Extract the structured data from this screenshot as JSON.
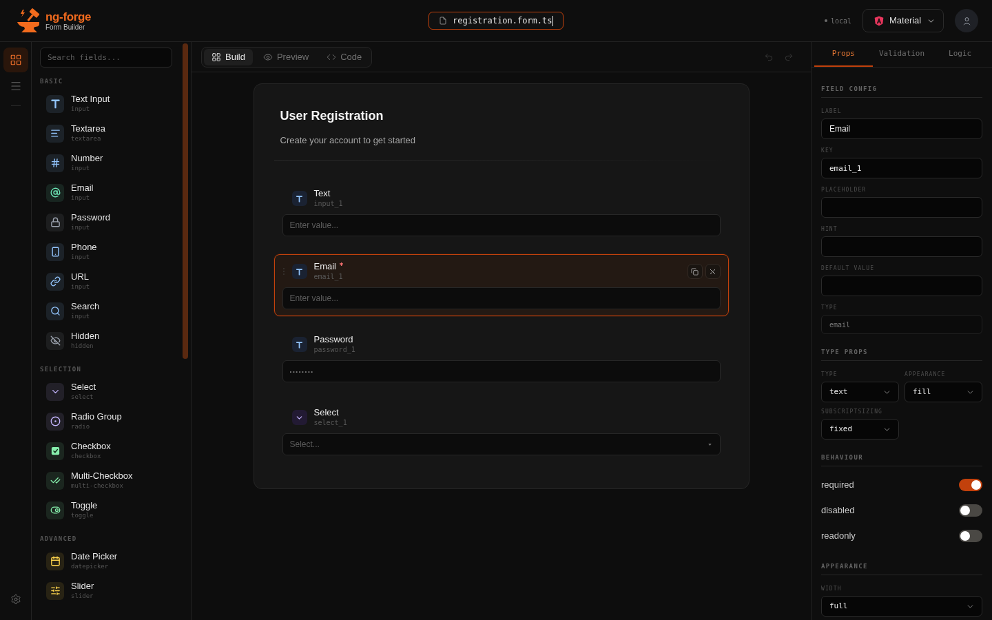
{
  "header": {
    "brand": {
      "name": "ng-forge",
      "tagline": "Form Builder"
    },
    "filename": "registration.form.ts",
    "environment": "local",
    "theme_button": "Material"
  },
  "rail": [
    {
      "kind": "grid",
      "selected": true
    },
    {
      "kind": "list",
      "selected": false
    }
  ],
  "palette": {
    "search_placeholder": "Search fields...",
    "groups": [
      {
        "title": "BASIC",
        "items": [
          {
            "kind": "text",
            "label": "Text Input",
            "type": "input",
            "color": "#93c5fd"
          },
          {
            "kind": "textarea",
            "label": "Textarea",
            "type": "textarea",
            "color": "#93c5fd"
          },
          {
            "kind": "number",
            "label": "Number",
            "type": "input",
            "color": "#93c5fd"
          },
          {
            "kind": "email",
            "label": "Email",
            "type": "input",
            "color": "#6ee7b7"
          },
          {
            "kind": "password",
            "label": "Password",
            "type": "input",
            "color": "#9ca3af"
          },
          {
            "kind": "phone",
            "label": "Phone",
            "type": "input",
            "color": "#93c5fd"
          },
          {
            "kind": "url",
            "label": "URL",
            "type": "input",
            "color": "#93c5fd"
          },
          {
            "kind": "search",
            "label": "Search",
            "type": "input",
            "color": "#93c5fd"
          },
          {
            "kind": "hidden",
            "label": "Hidden",
            "type": "hidden",
            "color": "#9ca3af"
          }
        ]
      },
      {
        "title": "SELECTION",
        "items": [
          {
            "kind": "select",
            "label": "Select",
            "type": "select",
            "color": "#c4b5fd"
          },
          {
            "kind": "radio",
            "label": "Radio Group",
            "type": "radio",
            "color": "#c4b5fd"
          },
          {
            "kind": "checkbox",
            "label": "Checkbox",
            "type": "checkbox",
            "color": "#86efac"
          },
          {
            "kind": "multi-checkbox",
            "label": "Multi-Checkbox",
            "type": "multi-checkbox",
            "color": "#86efac"
          },
          {
            "kind": "toggle",
            "label": "Toggle",
            "type": "toggle",
            "color": "#86efac"
          }
        ]
      },
      {
        "title": "ADVANCED",
        "items": [
          {
            "kind": "date",
            "label": "Date Picker",
            "type": "datepicker",
            "color": "#fcd34d"
          },
          {
            "kind": "slider",
            "label": "Slider",
            "type": "slider",
            "color": "#fcd34d"
          }
        ]
      }
    ]
  },
  "toolbar": {
    "tabs": [
      {
        "kind": "build",
        "label": "Build",
        "selected": true
      },
      {
        "kind": "preview",
        "label": "Preview",
        "selected": false
      },
      {
        "kind": "code",
        "label": "Code",
        "selected": false
      }
    ],
    "undo": {
      "disabled": true
    },
    "redo": {
      "disabled": true
    }
  },
  "form": {
    "title": "User Registration",
    "subtitle": "Create your account to get started",
    "fields": [
      {
        "kind": "input",
        "label": "Text",
        "key": "input_1",
        "placeholder": "Enter value...",
        "required": false,
        "selected": false
      },
      {
        "kind": "input",
        "label": "Email",
        "key": "email_1",
        "placeholder": "Enter value...",
        "required": true,
        "selected": true
      },
      {
        "kind": "password",
        "label": "Password",
        "key": "password_1",
        "value": "••••••••",
        "required": false,
        "selected": false
      },
      {
        "kind": "select",
        "label": "Select",
        "key": "select_1",
        "placeholder": "Select...",
        "required": false,
        "selected": false
      }
    ]
  },
  "inspector": {
    "tabs": [
      {
        "label": "Props",
        "selected": true
      },
      {
        "label": "Validation",
        "selected": false
      },
      {
        "label": "Logic",
        "selected": false
      }
    ],
    "sections": [
      {
        "title": "FIELD CONFIG",
        "kind": "inputs",
        "items": [
          {
            "label": "LABEL",
            "kind": "text",
            "value": "Email",
            "disabled": false
          },
          {
            "label": "KEY",
            "kind": "code",
            "value": "email_1",
            "disabled": false
          },
          {
            "label": "PLACEHOLDER",
            "kind": "text",
            "disabled": false
          },
          {
            "label": "HINT",
            "kind": "text",
            "disabled": false
          },
          {
            "label": "DEFAULT VALUE",
            "kind": "text",
            "disabled": false
          },
          {
            "label": "TYPE",
            "kind": "code",
            "value": "email",
            "disabled": true
          }
        ]
      },
      {
        "title": "TYPE PROPS",
        "kind": "select-grid",
        "items": [
          {
            "label": "TYPE",
            "value": "text"
          },
          {
            "label": "APPEARANCE",
            "value": "fill"
          },
          {
            "label": "SUBSCRIPTSIZING",
            "value": "fixed"
          }
        ]
      },
      {
        "title": "BEHAVIOUR",
        "kind": "toggles",
        "items": [
          {
            "label": "required",
            "on": true
          },
          {
            "label": "disabled",
            "on": false
          },
          {
            "label": "readonly",
            "on": false
          }
        ]
      },
      {
        "title": "APPEARANCE",
        "kind": "select-list",
        "items": [
          {
            "label": "WIDTH",
            "value": "full"
          }
        ]
      }
    ]
  }
}
